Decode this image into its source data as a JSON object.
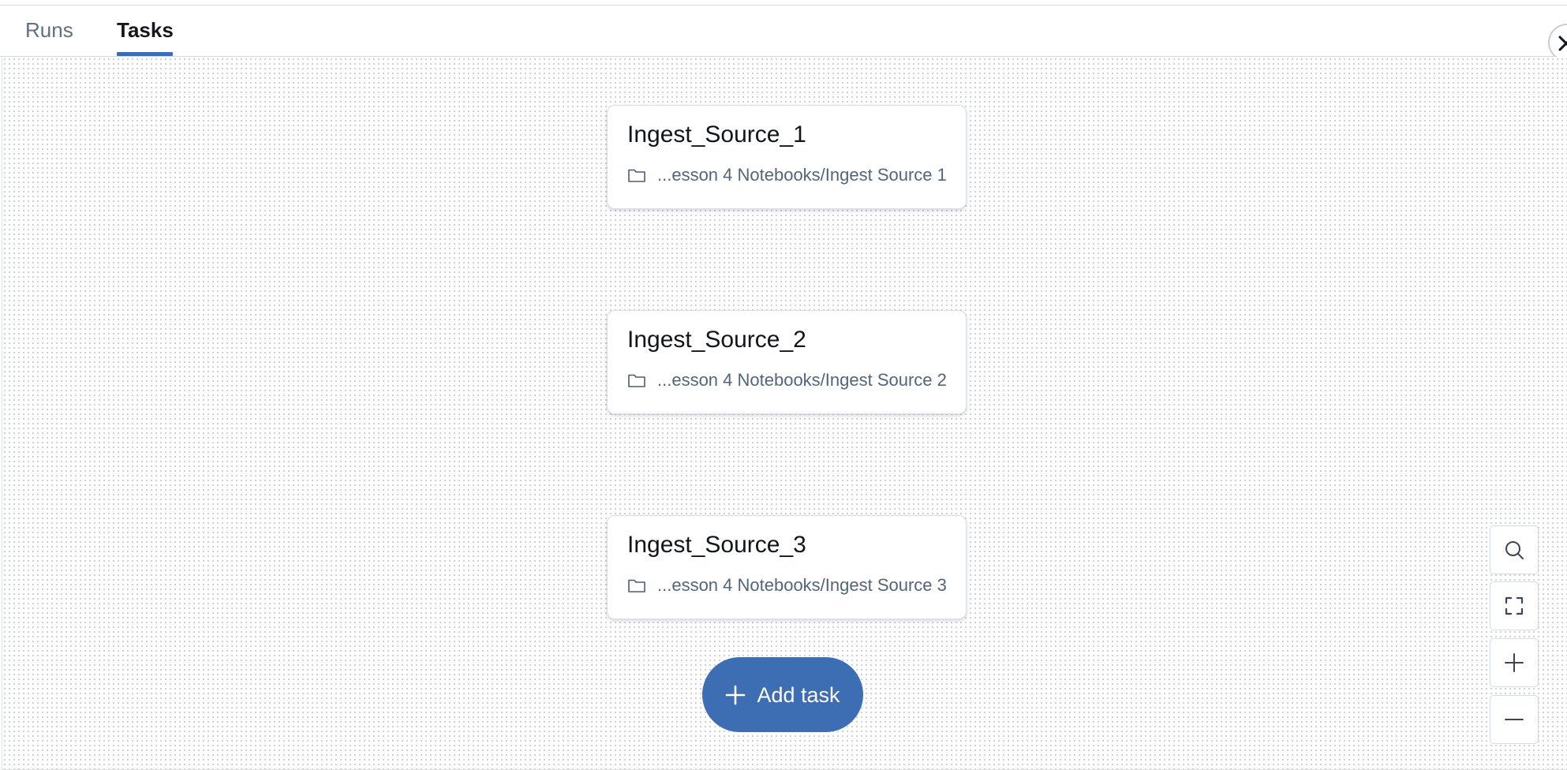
{
  "tabs": [
    {
      "label": "Runs",
      "active": false
    },
    {
      "label": "Tasks",
      "active": true
    }
  ],
  "tasks": [
    {
      "name": "Ingest_Source_1",
      "path": "...esson 4 Notebooks/Ingest Source 1",
      "icon": "folder-icon"
    },
    {
      "name": "Ingest_Source_2",
      "path": "...esson 4 Notebooks/Ingest Source 2",
      "icon": "folder-icon"
    },
    {
      "name": "Ingest_Source_3",
      "path": "...esson 4 Notebooks/Ingest Source 3",
      "icon": "folder-icon"
    }
  ],
  "add_task": {
    "label": "Add task",
    "icon": "plus-icon"
  },
  "canvas_controls": [
    {
      "name": "search",
      "icon": "search-icon"
    },
    {
      "name": "fit-view",
      "icon": "fullscreen-icon"
    },
    {
      "name": "zoom-in",
      "icon": "plus-icon"
    },
    {
      "name": "zoom-out",
      "icon": "minus-icon"
    }
  ],
  "colors": {
    "accent": "#3d6db3",
    "tab_active_text": "#13181f",
    "tab_inactive_text": "#5f6f82",
    "path_text": "#53657a"
  }
}
